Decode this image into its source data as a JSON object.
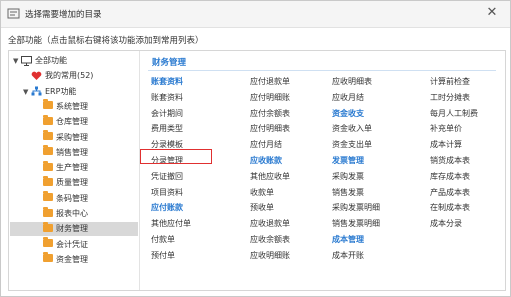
{
  "window": {
    "title": "选择需要增加的目录",
    "close": "✕"
  },
  "hint": "全部功能（点击鼠标右键将该功能添加到常用列表）",
  "tree": {
    "root": "全部功能",
    "favorites": "我的常用(52)",
    "erp": "ERP功能",
    "modules": [
      "系统管理",
      "仓库管理",
      "采购管理",
      "销售管理",
      "生产管理",
      "质量管理",
      "条码管理",
      "报表中心",
      "财务管理",
      "会计凭证",
      "资金管理"
    ],
    "selected_index": 8
  },
  "section_title": "财务管理",
  "columns": [
    [
      {
        "text": "账套资料",
        "group": true
      },
      {
        "text": "账套资料",
        "group": false
      },
      {
        "text": "会计期间",
        "group": false
      },
      {
        "text": "费用类型",
        "group": false
      },
      {
        "text": "分录模板",
        "group": false
      },
      {
        "text": "分录管理",
        "group": false
      },
      {
        "text": "凭证撤回",
        "group": false
      },
      {
        "text": "项目资料",
        "group": false
      },
      {
        "text": "应付账款",
        "group": true
      },
      {
        "text": "其他应付单",
        "group": false
      },
      {
        "text": "付款单",
        "group": false
      },
      {
        "text": "预付单",
        "group": false
      }
    ],
    [
      {
        "text": "应付退款单",
        "group": false
      },
      {
        "text": "应付明细账",
        "group": false
      },
      {
        "text": "应付余额表",
        "group": false
      },
      {
        "text": "应付明细表",
        "group": false
      },
      {
        "text": "应付月结",
        "group": false
      },
      {
        "text": "应收账款",
        "group": true
      },
      {
        "text": "其他应收单",
        "group": false
      },
      {
        "text": "收款单",
        "group": false
      },
      {
        "text": "预收单",
        "group": false
      },
      {
        "text": "应收退款单",
        "group": false
      },
      {
        "text": "应收余额表",
        "group": false
      },
      {
        "text": "应收明细账",
        "group": false
      }
    ],
    [
      {
        "text": "应收明细表",
        "group": false
      },
      {
        "text": "应收月结",
        "group": false
      },
      {
        "text": "资金收支",
        "group": true
      },
      {
        "text": "资金收入单",
        "group": false
      },
      {
        "text": "资金支出单",
        "group": false
      },
      {
        "text": "发票管理",
        "group": true
      },
      {
        "text": "采购发票",
        "group": false
      },
      {
        "text": "销售发票",
        "group": false
      },
      {
        "text": "采购发票明细",
        "group": false
      },
      {
        "text": "销售发票明细",
        "group": false
      },
      {
        "text": "成本管理",
        "group": true
      },
      {
        "text": "成本开账",
        "group": false
      }
    ],
    [
      {
        "text": "计算前检查",
        "group": false
      },
      {
        "text": "工时分摊表",
        "group": false
      },
      {
        "text": "每月人工制费",
        "group": false
      },
      {
        "text": "补充单价",
        "group": false
      },
      {
        "text": "成本计算",
        "group": false
      },
      {
        "text": "销货成本表",
        "group": false
      },
      {
        "text": "库存成本表",
        "group": false
      },
      {
        "text": "产品成本表",
        "group": false
      },
      {
        "text": "在制成本表",
        "group": false
      },
      {
        "text": "成本分录",
        "group": false
      }
    ]
  ],
  "highlighted_item": "分录模板",
  "colors": {
    "accent": "#2a7ad0",
    "highlight_border": "#e03030",
    "folder": "#f0a030",
    "heart": "#e03030"
  }
}
